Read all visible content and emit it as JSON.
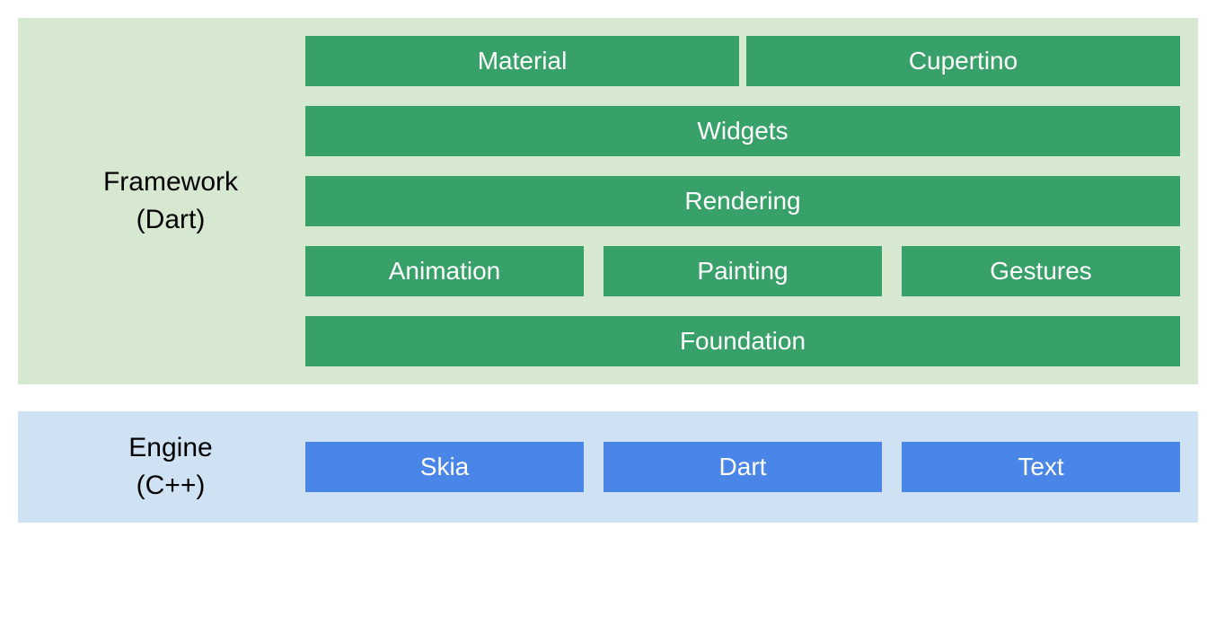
{
  "framework": {
    "label_line1": "Framework",
    "label_line2": "(Dart)",
    "rows": {
      "top": {
        "material": "Material",
        "cupertino": "Cupertino"
      },
      "widgets": "Widgets",
      "rendering": "Rendering",
      "mid": {
        "animation": "Animation",
        "painting": "Painting",
        "gestures": "Gestures"
      },
      "foundation": "Foundation"
    }
  },
  "engine": {
    "label_line1": "Engine",
    "label_line2": "(C++)",
    "items": {
      "skia": "Skia",
      "dart": "Dart",
      "text": "Text"
    }
  }
}
